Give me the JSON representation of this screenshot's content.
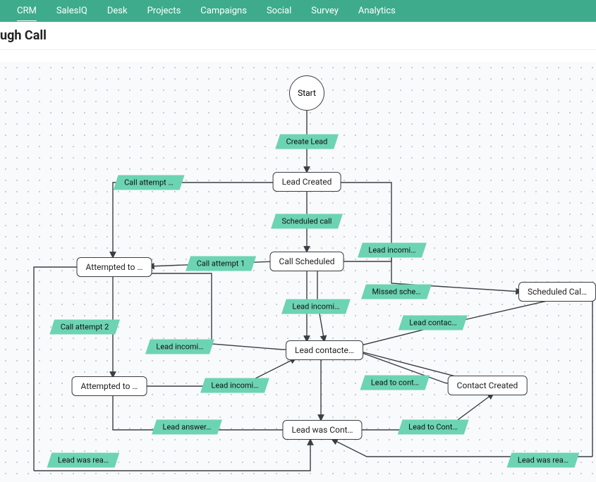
{
  "topnav": {
    "items": [
      "CRM",
      "SalesIQ",
      "Desk",
      "Projects",
      "Campaigns",
      "Social",
      "Survey",
      "Analytics"
    ],
    "active_index": 0
  },
  "subheader": {
    "title": "ugh Call"
  },
  "flow": {
    "start_label": "Start",
    "nodes": {
      "lead_created": "Lead Created",
      "call_scheduled": "Call Scheduled",
      "attempted_1": "Attempted to …",
      "attempted_2": "Attempted to …",
      "lead_contacted": "Lead contacte…",
      "scheduled_call": "Scheduled Cal…",
      "lead_was_cont": "Lead was Cont…",
      "contact_created": "Contact Created"
    },
    "edge_labels": {
      "create_lead": "Create Lead",
      "scheduled_call": "Scheduled call",
      "call_attempt_top": "Call attempt …",
      "call_attempt_1": "Call attempt 1",
      "call_attempt_2": "Call attempt 2",
      "lead_incoming_1": "Lead incomi…",
      "lead_incoming_2": "Lead incomi…",
      "lead_incoming_3": "Lead incomi…",
      "lead_incoming_4": "Lead incomi…",
      "missed_sched": "Missed sche…",
      "lead_contac": "Lead contac…",
      "lead_to_cont_1": "Lead to cont…",
      "lead_to_cont_2": "Lead to Cont…",
      "lead_answer": "Lead answer…",
      "lead_was_rea_l": "Lead was rea…",
      "lead_was_rea_r": "Lead was rea…"
    }
  }
}
